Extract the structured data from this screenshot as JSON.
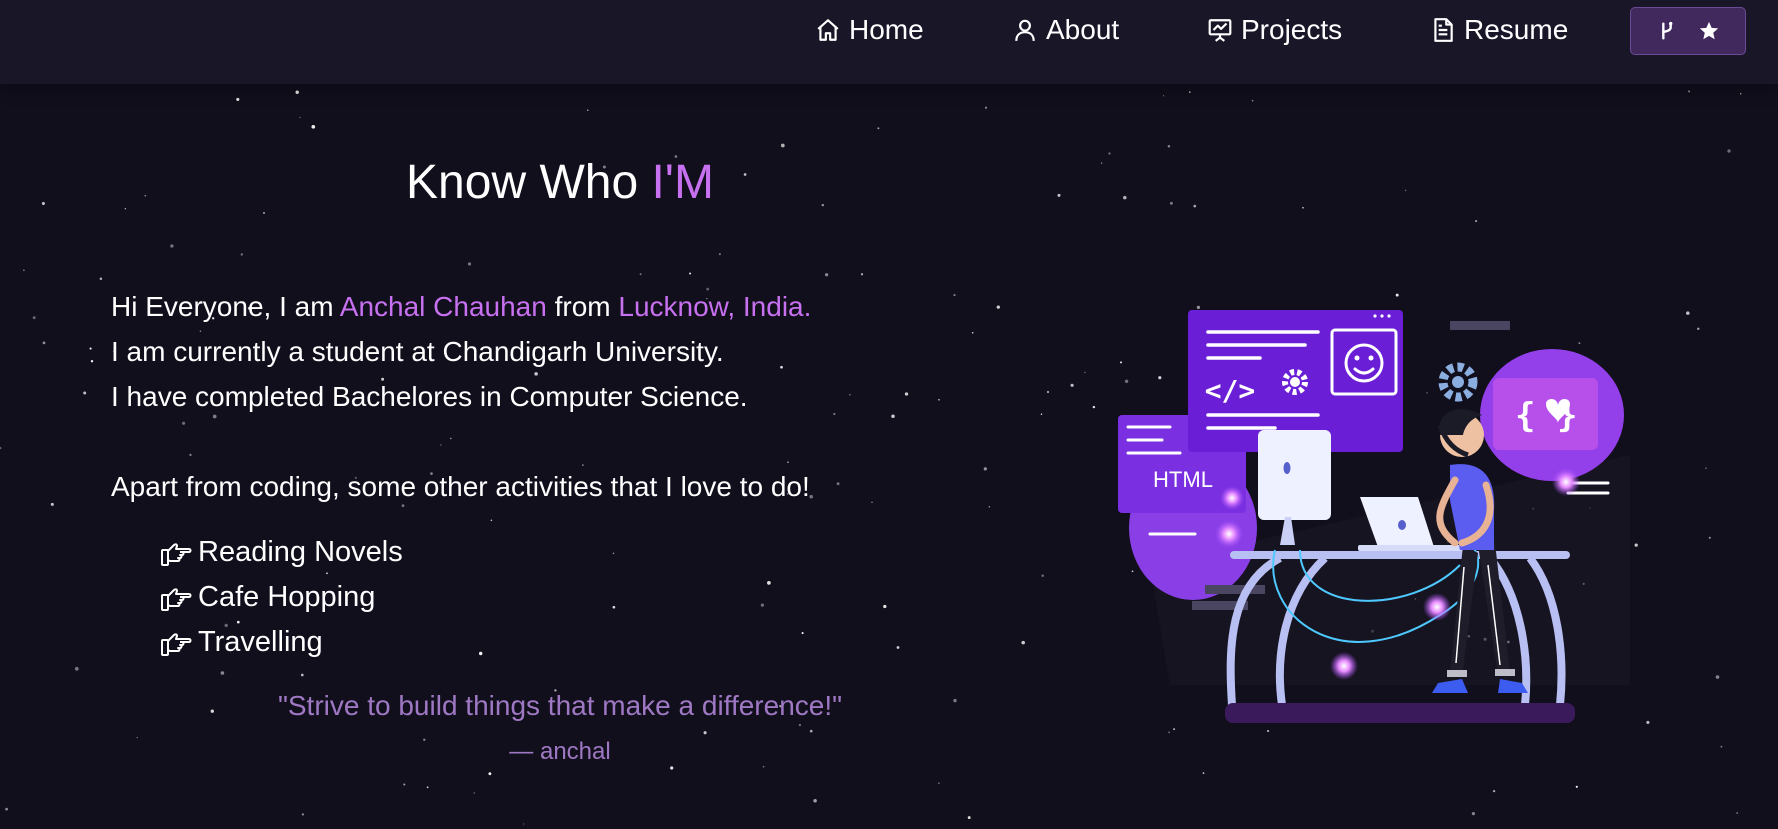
{
  "nav": {
    "items": [
      {
        "label": "Home",
        "icon": "home-icon"
      },
      {
        "label": "About",
        "icon": "user-icon"
      },
      {
        "label": "Projects",
        "icon": "presentation-chart-icon"
      },
      {
        "label": "Resume",
        "icon": "document-icon"
      }
    ],
    "github_button": {
      "icons": [
        "git-fork-icon",
        "star-icon"
      ]
    }
  },
  "about": {
    "title_prefix": "Know Who ",
    "title_accent": "I'M",
    "intro_prefix": "Hi Everyone, I am ",
    "name": "Anchal Chauhan",
    "from_word": " from ",
    "location": "Lucknow, India.",
    "line2": "I am currently a student at Chandigarh University.",
    "line3": "I have completed Bachelores in Computer Science.",
    "activities_intro": "Apart from coding, some other activities that I love to do!",
    "activities": [
      "Reading Novels",
      "Cafe Hopping",
      "Travelling"
    ],
    "activity_icon": "hand-point-right-icon",
    "quote": "\"Strive to build things that make a difference!\"",
    "author": "— anchal"
  },
  "illustration": {
    "html_label": "HTML",
    "code_symbol": "</>"
  },
  "colors": {
    "background": "#120f1d",
    "navbar": "#191628",
    "accent": "#c770f0",
    "quote": "#9f78c4",
    "github_button": "#41295e"
  }
}
